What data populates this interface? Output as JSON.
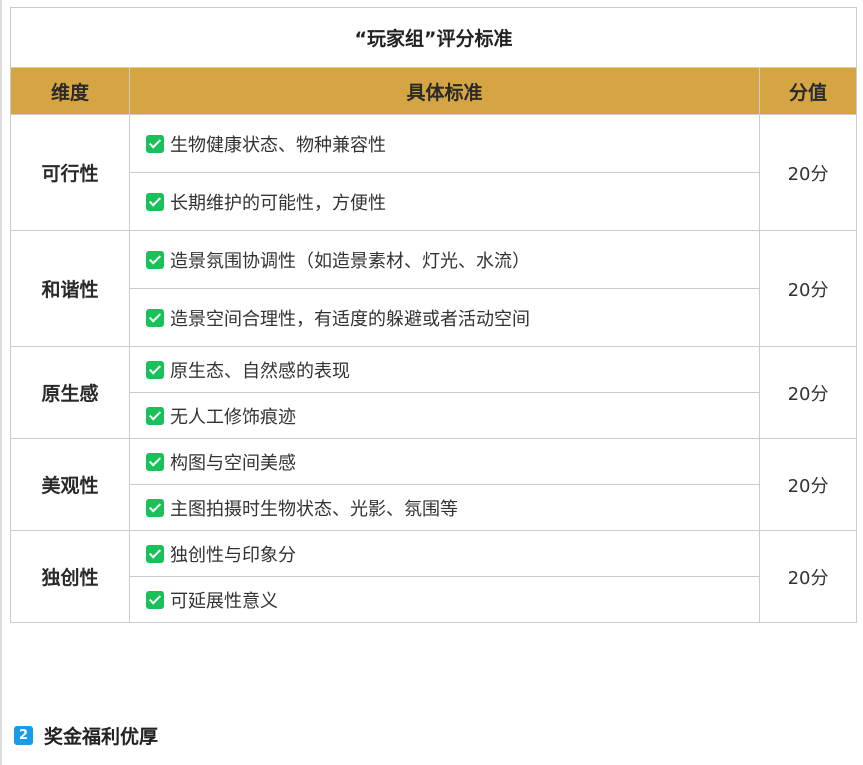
{
  "table": {
    "title": "“玩家组”评分标准",
    "headers": {
      "dimension": "维度",
      "criteria": "具体标准",
      "score": "分值"
    },
    "rows": [
      {
        "dimension": "可行性",
        "score": "20分",
        "criteria": [
          "生物健康状态、物种兼容性",
          "长期维护的可能性，方便性"
        ]
      },
      {
        "dimension": "和谐性",
        "score": "20分",
        "criteria": [
          "造景氛围协调性（如造景素材、灯光、水流）",
          "造景空间合理性，有适度的躲避或者活动空间"
        ]
      },
      {
        "dimension": "原生感",
        "score": "20分",
        "criteria": [
          "原生态、自然感的表现",
          "无人工修饰痕迹"
        ]
      },
      {
        "dimension": "美观性",
        "score": "20分",
        "criteria": [
          "构图与空间美感",
          "主图拍摄时生物状态、光影、氛围等"
        ]
      },
      {
        "dimension": "独创性",
        "score": "20分",
        "criteria": [
          "独创性与印象分",
          "可延展性意义"
        ]
      }
    ],
    "check_icon": "check-box-icon",
    "header_color": "#d4a542",
    "check_color": "#19c15a"
  },
  "section": {
    "number": "2",
    "title": "奖金福利优厚",
    "badge_color": "#1a9be8"
  }
}
